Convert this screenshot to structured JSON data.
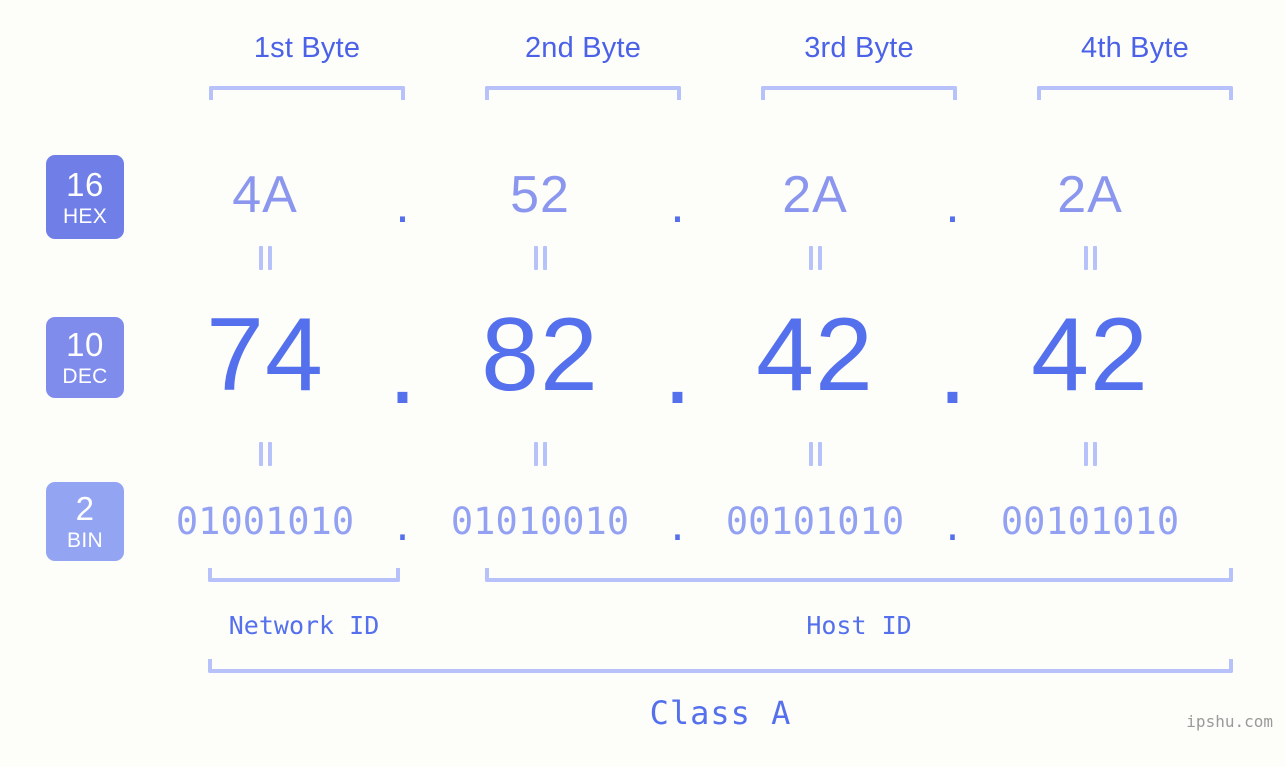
{
  "meta": {
    "watermark": "ipshu.com",
    "background_color": "#fdfdfa",
    "accent_color": "#5470ec",
    "light_accent_color": "#b7c2fb"
  },
  "byte_headers": [
    {
      "label": "1st Byte"
    },
    {
      "label": "2nd Byte"
    },
    {
      "label": "3rd Byte"
    },
    {
      "label": "4th Byte"
    }
  ],
  "bases": [
    {
      "number": "16",
      "name": "HEX",
      "color": "#707ee8"
    },
    {
      "number": "10",
      "name": "DEC",
      "color": "#808ceb"
    },
    {
      "number": "2",
      "name": "BIN",
      "color": "#93a5f2"
    }
  ],
  "rows": {
    "hex": {
      "base": "16",
      "base_name": "HEX",
      "values": [
        "4A",
        "52",
        "2A",
        "2A"
      ],
      "separator": "."
    },
    "dec": {
      "base": "10",
      "base_name": "DEC",
      "values": [
        "74",
        "82",
        "42",
        "42"
      ],
      "separator": "."
    },
    "bin": {
      "base": "2",
      "base_name": "BIN",
      "values": [
        "01001010",
        "01010010",
        "00101010",
        "00101010"
      ],
      "separator": "."
    }
  },
  "equality_symbol": "||",
  "sections": {
    "network_id": "Network ID",
    "host_id": "Host ID",
    "class": "Class A"
  }
}
